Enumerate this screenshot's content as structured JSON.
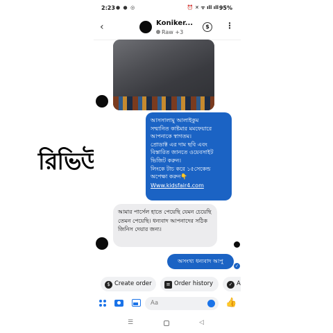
{
  "overlay": {
    "review_label": "রিভিউ"
  },
  "status_bar": {
    "time": "2:23",
    "notif_icons": "● ● ◎",
    "system_icons": "⏰ ✕ ᯤ ıll ıll",
    "battery": "95%"
  },
  "header": {
    "contact_name": "Koniker...",
    "contact_sub": "Raw +3",
    "back_icon": "‹",
    "currency_icon": "$",
    "menu_icon": "⋮"
  },
  "messages": {
    "outgoing_1": {
      "lines": [
        "আসসালামু আলাইকুম",
        "সম্মানিত কাষ্টমার মমফেয়ারে",
        "আপনাকে স্বাগতম।",
        "প্রোডাক্ট এর দাম ছবি এবং",
        "বিস্তারিত জানতে ওয়েবসাইট",
        "ভিজিট করুন।",
        "লিংকে টাচ করে ১৫সেকেন্ড",
        "অপেক্ষা করুন👇"
      ],
      "link": "Www.kidsfair4.com"
    },
    "incoming_1": "আমার পার্সেল হাতে পেয়েছি যেমন চেয়েছি তেমন পেয়েছি। ধন্যবাদ আপনাদের সঠিক জিনিস দেয়ার জন্য।",
    "outgoing_2": "অসংখ্য ধন্যবাদ আপু",
    "read_check": "✓"
  },
  "quick_actions": [
    {
      "label": "Create order",
      "icon": "$"
    },
    {
      "label": "Order history",
      "icon": "≡"
    },
    {
      "label": "A",
      "icon": "✓"
    }
  ],
  "composer": {
    "placeholder": "Aa",
    "like_icon": "👍"
  },
  "nav": {
    "recents": "☰",
    "back": "◁"
  }
}
